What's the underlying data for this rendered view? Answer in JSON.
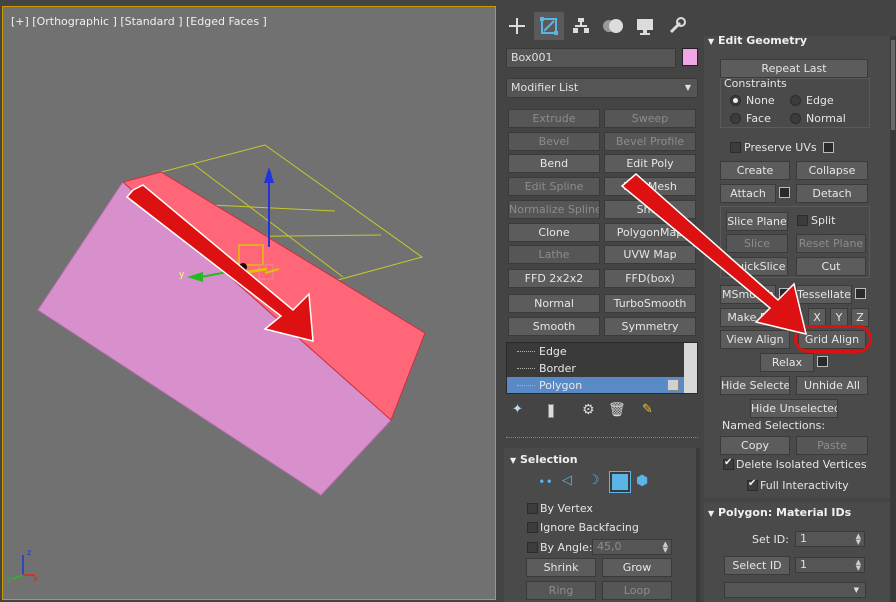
{
  "viewport": {
    "label": "[+] [Orthographic ] [Standard ] [Edged Faces ]",
    "axis_labels": {
      "x": "x",
      "y": "y",
      "z": "z"
    },
    "colors": {
      "box_side": "#d890cc",
      "box_top": "#ff6677",
      "gizmo_z": "#2233dd",
      "gizmo_y": "#22bb22",
      "grid_helper": "#c8c828",
      "annotation": "#dd1111"
    }
  },
  "command_panel": {
    "tabs": [
      "create-icon",
      "modify-icon",
      "hierarchy-icon",
      "motion-icon",
      "display-icon",
      "utilities-icon"
    ],
    "object_name": "Box001",
    "object_color": "#f3a6e6",
    "modifier_list": "Modifier List",
    "modifier_buttons": [
      {
        "label": "Extrude",
        "enabled": false
      },
      {
        "label": "Sweep",
        "enabled": false
      },
      {
        "label": "Bevel",
        "enabled": false
      },
      {
        "label": "Bevel Profile",
        "enabled": false
      },
      {
        "label": "Bend",
        "enabled": true
      },
      {
        "label": "Edit Poly",
        "enabled": true
      },
      {
        "label": "Edit Spline",
        "enabled": false
      },
      {
        "label": "Edit Mesh",
        "enabled": true
      },
      {
        "label": "Normalize Spline",
        "enabled": false
      },
      {
        "label": "Shell",
        "enabled": true
      },
      {
        "label": "Clone",
        "enabled": true
      },
      {
        "label": "PolygonMap",
        "enabled": true
      },
      {
        "label": "Lathe",
        "enabled": false
      },
      {
        "label": "UVW Map",
        "enabled": true
      },
      {
        "label": "FFD 2x2x2",
        "enabled": true
      },
      {
        "label": "FFD(box)",
        "enabled": true
      },
      {
        "label": "Normal",
        "enabled": true
      },
      {
        "label": "TurboSmooth",
        "enabled": true
      },
      {
        "label": "Smooth",
        "enabled": true
      },
      {
        "label": "Symmetry",
        "enabled": true
      }
    ],
    "stack_items": [
      "Edge",
      "Border",
      "Polygon"
    ],
    "selection": {
      "title": "Selection",
      "by_vertex": "By Vertex",
      "ignore_backfacing": "Ignore Backfacing",
      "by_angle": "By Angle:",
      "angle_value": "45,0",
      "shrink": "Shrink",
      "grow": "Grow",
      "ring": "Ring",
      "loop": "Loop"
    },
    "edit_geometry": {
      "title": "Edit Geometry",
      "repeat_last": "Repeat Last",
      "constraints": "Constraints",
      "none": "None",
      "edge": "Edge",
      "face": "Face",
      "normal": "Normal",
      "preserve_uvs": "Preserve UVs",
      "create": "Create",
      "collapse": "Collapse",
      "attach": "Attach",
      "detach": "Detach",
      "slice_plane": "Slice Plane",
      "split": "Split",
      "slice": "Slice",
      "reset_plane": "Reset Plane",
      "quickslice": "QuickSlice",
      "cut": "Cut",
      "msmooth": "MSmooth",
      "tessellate": "Tessellate",
      "make_planar": "Make Planar",
      "x": "X",
      "y": "Y",
      "z": "Z",
      "view_align": "View Align",
      "grid_align": "Grid Align",
      "relax": "Relax",
      "hide_selected": "Hide Selected",
      "unhide_all": "Unhide All",
      "hide_unselected": "Hide Unselected",
      "named_selections": "Named Selections:",
      "copy": "Copy",
      "paste": "Paste",
      "delete_isolated": "Delete Isolated Vertices",
      "full_interactivity": "Full Interactivity"
    },
    "material_ids": {
      "title": "Polygon: Material IDs",
      "set_id": "Set ID:",
      "set_id_value": "1",
      "select_id": "Select ID",
      "select_id_value": "1"
    }
  }
}
